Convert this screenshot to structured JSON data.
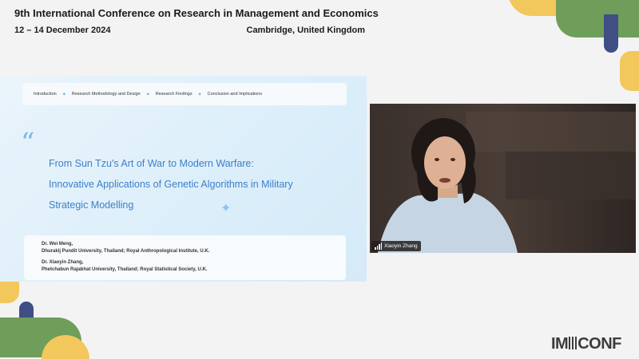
{
  "header": {
    "title": "9th International Conference on Research in Management and Economics",
    "date": "12 – 14 December 2024",
    "location": "Cambridge, United Kingdom"
  },
  "slide": {
    "nav_items": [
      "Introduction",
      "Research Methodology and Design",
      "Research Findings",
      "Conclusion and Implications"
    ],
    "title_lines": [
      "From Sun Tzu's Art of War to Modern Warfare:",
      "Innovative Applications of Genetic Algorithms in Military",
      "Strategic Modelling"
    ],
    "authors": [
      {
        "name": "Dr. Wei Meng,",
        "affiliation": "Dhurakij Pundit University, Thailand;  Royal Anthropological Institute, U.K."
      },
      {
        "name": "Dr. Xiaoyin Zhang,",
        "affiliation": "Phetchabun Rajabhat University, Thailand;  Royal Statistical Society, U.K."
      }
    ]
  },
  "video": {
    "participant_name": "Xiaoyin Zhang",
    "icon": "signal-icon"
  },
  "logo": {
    "prefix": "IM",
    "suffix": "CONF"
  },
  "colors": {
    "accent_blue": "#3d7fc8",
    "deco_yellow": "#f2c75c",
    "deco_green": "#6e9e5a",
    "deco_navy": "#3f4f86"
  }
}
